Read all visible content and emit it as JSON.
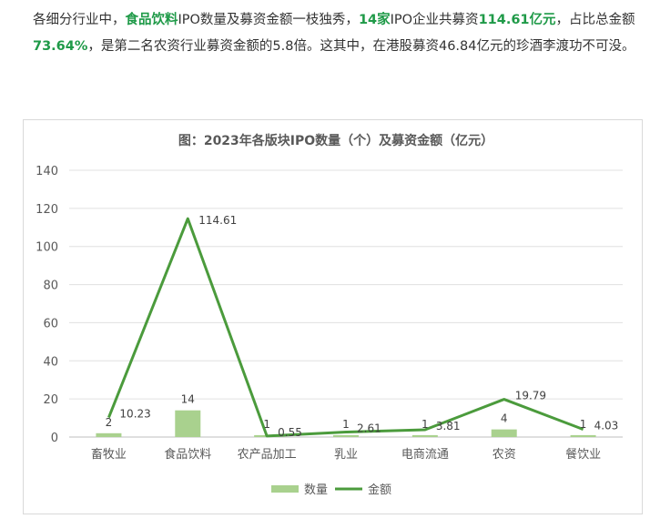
{
  "paragraph": [
    {
      "t": "各细分行业中，",
      "b": false
    },
    {
      "t": "食品饮料",
      "b": true
    },
    {
      "t": "IPO数量及募资金额一枝独秀，",
      "b": false
    },
    {
      "t": "14家",
      "b": true
    },
    {
      "t": "IPO企业共募资",
      "b": false
    },
    {
      "t": "114.61亿元",
      "b": true
    },
    {
      "t": "，占比总金额",
      "b": false
    },
    {
      "t": "73.64%",
      "b": true
    },
    {
      "t": "，是第二名农资行业募资金额的5.8倍。这其中，在港股募资46.84亿元的珍酒李渡功不可没。",
      "b": false
    }
  ],
  "colors": {
    "highlight": "#1f9a48",
    "bar": "#a9d18e",
    "line": "#4b9b3c"
  },
  "chart_data": {
    "type": "bar+line",
    "title": "图：2023年各版块IPO数量（个）及募资金额（亿元）",
    "categories": [
      "畜牧业",
      "食品饮料",
      "农产品加工",
      "乳业",
      "电商流通",
      "农资",
      "餐饮业"
    ],
    "series": [
      {
        "name": "数量",
        "type": "bar",
        "values": [
          2,
          14,
          1,
          1,
          1,
          4,
          1
        ]
      },
      {
        "name": "金额",
        "type": "line",
        "values": [
          10.23,
          114.61,
          0.55,
          2.61,
          3.81,
          19.79,
          4.03
        ]
      }
    ],
    "ylim": [
      0,
      140
    ],
    "yticks": [
      "0",
      "20",
      "40",
      "60",
      "80",
      "100",
      "120",
      "140"
    ],
    "grid": true,
    "legend": "bottom"
  }
}
